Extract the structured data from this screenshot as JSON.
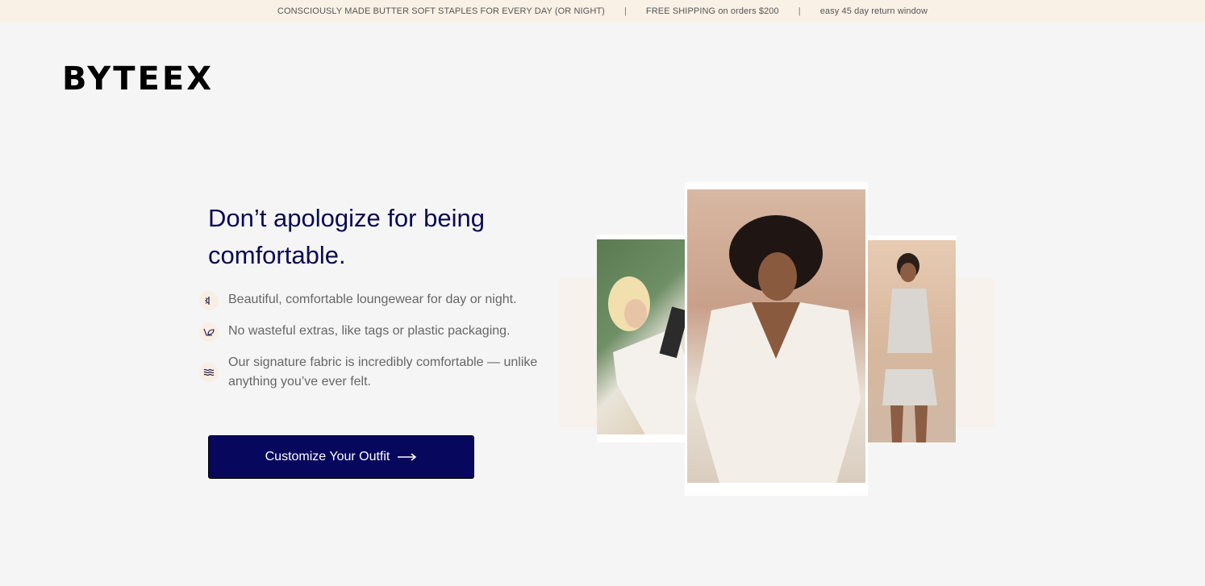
{
  "announcement": {
    "items": [
      "CONSCIOUSLY MADE BUTTER SOFT STAPLES FOR EVERY DAY (OR NIGHT)",
      "FREE SHIPPING on orders $200",
      "easy 45 day return window"
    ],
    "separator": "|"
  },
  "brand": {
    "logo": "BYTEEX"
  },
  "hero": {
    "headline": "Don’t apologize for being comfortable.",
    "features": [
      {
        "icon": "sun-icon",
        "text": "Beautiful, comfortable loungewear for day or night."
      },
      {
        "icon": "leaf-icon",
        "text": "No wasteful extras, like tags or plastic packaging."
      },
      {
        "icon": "waves-icon",
        "text": "Our signature fabric is incredibly comfortable — unlike anything you’ve ever felt."
      }
    ],
    "cta": {
      "label": "Customize Your Outfit"
    }
  },
  "colors": {
    "announcement_bg": "#faf1e6",
    "headline": "#0c0a52",
    "cta_bg": "#07075e",
    "page_bg": "#f5f5f5"
  }
}
